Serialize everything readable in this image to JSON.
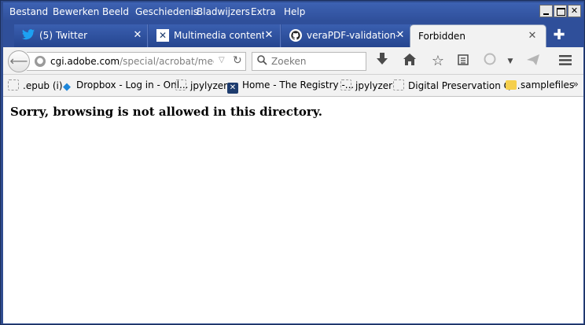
{
  "menubar": {
    "items": [
      {
        "label": "Bestand"
      },
      {
        "label": "Bewerken"
      },
      {
        "label": "Beeld"
      },
      {
        "label": "Geschiedenis"
      },
      {
        "label": "Bladwijzers"
      },
      {
        "label": "Extra"
      },
      {
        "label": "Help"
      }
    ],
    "window_buttons": {
      "minimize": "minimize",
      "maximize": "maximize",
      "close": "✕"
    }
  },
  "tabs": [
    {
      "label": "(5) Twitter",
      "icon": "twitter-icon",
      "active": false
    },
    {
      "label": "Multimedia content - ...",
      "icon": "registry-icon",
      "active": false
    },
    {
      "label": "veraPDF-validation-...",
      "icon": "github-icon",
      "active": false
    },
    {
      "label": "Forbidden",
      "icon": "",
      "active": true
    }
  ],
  "navbar": {
    "url_host": "cgi.adobe.com",
    "url_path": "/special/acrobat/mediaplayer",
    "search_placeholder": "Zoeken"
  },
  "bookmarks": [
    {
      "label": ".epub (i)",
      "icon": "blank"
    },
    {
      "label": "Dropbox - Log in - Onl...",
      "icon": "dropbox"
    },
    {
      "label": "jpylyzer",
      "icon": "blank"
    },
    {
      "label": "Home - The Registry -...",
      "icon": "registry"
    },
    {
      "label": "jpylyzer",
      "icon": "blank"
    },
    {
      "label": "Digital Preservation Q...",
      "icon": "blank"
    },
    {
      "label": "samplefiles",
      "icon": "folder"
    }
  ],
  "content": {
    "message": "Sorry, browsing is not allowed in this directory."
  },
  "colors": {
    "frame": "#2f4c8f",
    "toolbar": "#f2f2f2",
    "twitter": "#1da1f2"
  }
}
